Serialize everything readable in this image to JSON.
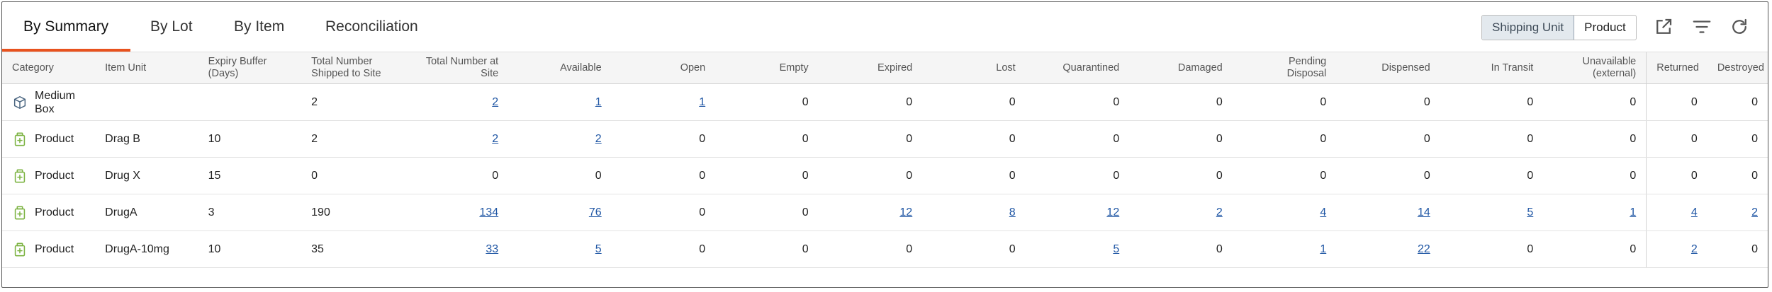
{
  "tabs": [
    {
      "label": "By Summary",
      "active": true
    },
    {
      "label": "By Lot",
      "active": false
    },
    {
      "label": "By Item",
      "active": false
    },
    {
      "label": "Reconciliation",
      "active": false
    }
  ],
  "view_toggle": {
    "shipping_unit": "Shipping Unit",
    "product": "Product",
    "selected": "Shipping Unit"
  },
  "toolbar_icons": [
    "export-icon",
    "filter-icon",
    "refresh-icon"
  ],
  "colors": {
    "accent": "#e8521e",
    "link": "#1f56a4",
    "product_icon": "#7cb342",
    "box_icon": "#4a6580"
  },
  "columns": {
    "category": "Category",
    "item_unit": "Item Unit",
    "expiry_1": "Expiry Buffer",
    "expiry_2": "(Days)",
    "shipped_1": "Total Number",
    "shipped_2": "Shipped to Site",
    "atsite_1": "Total Number at",
    "atsite_2": "Site",
    "available": "Available",
    "open": "Open",
    "empty": "Empty",
    "expired": "Expired",
    "lost": "Lost",
    "quarantined": "Quarantined",
    "damaged": "Damaged",
    "pending_1": "Pending",
    "pending_2": "Disposal",
    "dispensed": "Dispensed",
    "transit": "In Transit",
    "unavail_1": "Unavailable",
    "unavail_2": "(external)",
    "returned": "Returned",
    "destroyed": "Destroyed"
  },
  "rows": [
    {
      "icon": "box-icon",
      "category_1": "Medium",
      "category_2": "Box",
      "item_unit": "",
      "expiry": "",
      "shipped": "2",
      "atsite": "2",
      "available": "1",
      "open": "1",
      "empty": "0",
      "expired": "0",
      "lost": "0",
      "quarantined": "0",
      "damaged": "0",
      "pending": "0",
      "dispensed": "0",
      "transit": "0",
      "unavail": "0",
      "returned": "0",
      "destroyed": "0"
    },
    {
      "icon": "product-bottle-icon",
      "category_1": "Product",
      "category_2": "",
      "item_unit": "Drag B",
      "expiry": "10",
      "shipped": "2",
      "atsite": "2",
      "available": "2",
      "open": "0",
      "empty": "0",
      "expired": "0",
      "lost": "0",
      "quarantined": "0",
      "damaged": "0",
      "pending": "0",
      "dispensed": "0",
      "transit": "0",
      "unavail": "0",
      "returned": "0",
      "destroyed": "0"
    },
    {
      "icon": "product-bottle-icon",
      "category_1": "Product",
      "category_2": "",
      "item_unit": "Drug X",
      "expiry": "15",
      "shipped": "0",
      "atsite": "0",
      "available": "0",
      "open": "0",
      "empty": "0",
      "expired": "0",
      "lost": "0",
      "quarantined": "0",
      "damaged": "0",
      "pending": "0",
      "dispensed": "0",
      "transit": "0",
      "unavail": "0",
      "returned": "0",
      "destroyed": "0"
    },
    {
      "icon": "product-bottle-icon",
      "category_1": "Product",
      "category_2": "",
      "item_unit": "DrugA",
      "expiry": "3",
      "shipped": "190",
      "atsite": "134",
      "available": "76",
      "open": "0",
      "empty": "0",
      "expired": "12",
      "lost": "8",
      "quarantined": "12",
      "damaged": "2",
      "pending": "4",
      "dispensed": "14",
      "transit": "5",
      "unavail": "1",
      "returned": "4",
      "destroyed": "2"
    },
    {
      "icon": "product-bottle-icon",
      "category_1": "Product",
      "category_2": "",
      "item_unit": "DrugA-10mg",
      "expiry": "10",
      "shipped": "35",
      "atsite": "33",
      "available": "5",
      "open": "0",
      "empty": "0",
      "expired": "0",
      "lost": "0",
      "quarantined": "5",
      "damaged": "0",
      "pending": "1",
      "dispensed": "22",
      "transit": "0",
      "unavail": "0",
      "returned": "2",
      "destroyed": "0"
    }
  ]
}
